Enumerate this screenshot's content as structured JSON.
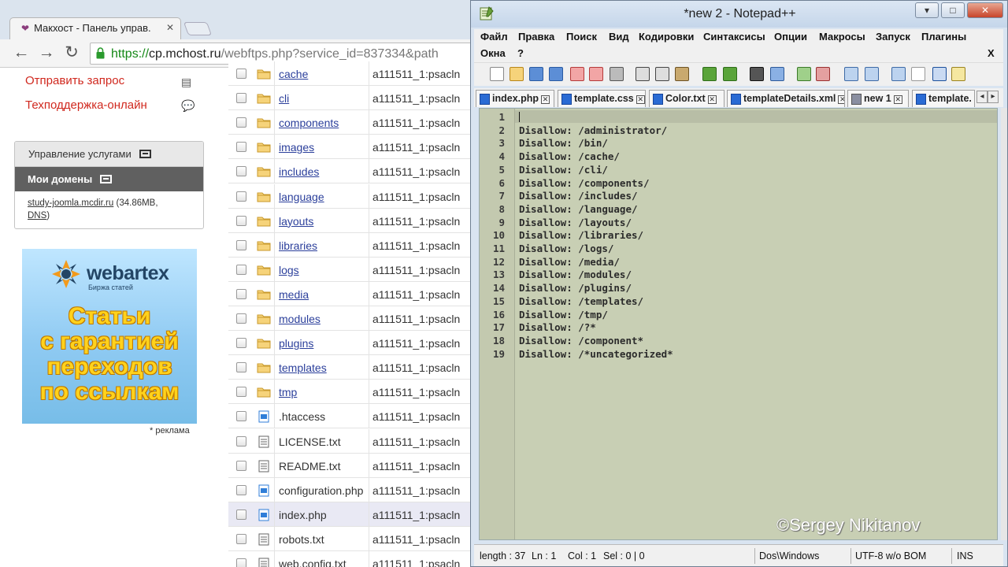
{
  "browser": {
    "tab_title": "Макхост - Панель управ.",
    "tab_close": "✕",
    "url_scheme": "https://",
    "url_host": "cp.mchost.ru",
    "url_path": "/webftps.php?service_id=837334&path",
    "nav": {
      "back": "←",
      "forward": "→",
      "reload": "↻"
    }
  },
  "sidebar": {
    "request_link": "Отправить запрос",
    "support_link": "Техподдержка-онлайн",
    "services_header": "Управление услугами",
    "domains_header": "Мои домены",
    "domain_name": "study-joomla.mcdir.ru",
    "domain_size": "(34.86MB,",
    "domain_dns": "DNS",
    "domain_close": ")",
    "ad": {
      "brand": "webartex",
      "tagline": "Биржа статей",
      "line1": "Статьи",
      "line2": "с гарантией",
      "line3": "переходов",
      "line4": "по ссылкам",
      "note": "* реклама"
    }
  },
  "files": [
    {
      "name": "cache",
      "type": "dir",
      "owner": "a111511_1:psacln"
    },
    {
      "name": "cli",
      "type": "dir",
      "owner": "a111511_1:psacln"
    },
    {
      "name": "components",
      "type": "dir",
      "owner": "a111511_1:psacln"
    },
    {
      "name": "images",
      "type": "dir",
      "owner": "a111511_1:psacln"
    },
    {
      "name": "includes",
      "type": "dir",
      "owner": "a111511_1:psacln"
    },
    {
      "name": "language",
      "type": "dir",
      "owner": "a111511_1:psacln"
    },
    {
      "name": "layouts",
      "type": "dir",
      "owner": "a111511_1:psacln"
    },
    {
      "name": "libraries",
      "type": "dir",
      "owner": "a111511_1:psacln"
    },
    {
      "name": "logs",
      "type": "dir",
      "owner": "a111511_1:psacln"
    },
    {
      "name": "media",
      "type": "dir",
      "owner": "a111511_1:psacln"
    },
    {
      "name": "modules",
      "type": "dir",
      "owner": "a111511_1:psacln"
    },
    {
      "name": "plugins",
      "type": "dir",
      "owner": "a111511_1:psacln"
    },
    {
      "name": "templates",
      "type": "dir",
      "owner": "a111511_1:psacln"
    },
    {
      "name": "tmp",
      "type": "dir",
      "owner": "a111511_1:psacln"
    },
    {
      "name": ".htaccess",
      "type": "code",
      "owner": "a111511_1:psacln"
    },
    {
      "name": "LICENSE.txt",
      "type": "text",
      "owner": "a111511_1:psacln"
    },
    {
      "name": "README.txt",
      "type": "text",
      "owner": "a111511_1:psacln"
    },
    {
      "name": "configuration.php",
      "type": "code",
      "owner": "a111511_1:psacln"
    },
    {
      "name": "index.php",
      "type": "code",
      "owner": "a111511_1:psacln",
      "selected": true
    },
    {
      "name": "robots.txt",
      "type": "text",
      "owner": "a111511_1:psacln"
    },
    {
      "name": "web.config.txt",
      "type": "text",
      "owner": "a111511_1:psacln"
    }
  ],
  "notepad": {
    "title": "*new  2 - Notepad++",
    "window_buttons": {
      "minimize": "▾",
      "maximize": "□",
      "close": "✕"
    },
    "menu": [
      "Файл",
      "Правка",
      "Поиск",
      "Вид",
      "Кодировки",
      "Синтаксисы",
      "Опции",
      "Макросы",
      "Запуск",
      "Плагины",
      "Окна",
      "?"
    ],
    "menu_close": "X",
    "tabs": [
      {
        "label": "index.php",
        "close": "✕"
      },
      {
        "label": "template.css",
        "close": "✕"
      },
      {
        "label": "Color.txt",
        "close": "✕"
      },
      {
        "label": "templateDetails.xml",
        "close": "✕"
      },
      {
        "label": "new  1",
        "close": "✕",
        "unsaved": true
      },
      {
        "label": "template.",
        "close": ""
      }
    ],
    "tab_scroll": {
      "left": "◂",
      "right": "▸"
    },
    "lines": [
      {
        "num": "1",
        "text": ""
      },
      {
        "num": "2",
        "text": "Disallow: /administrator/"
      },
      {
        "num": "3",
        "text": "Disallow: /bin/"
      },
      {
        "num": "4",
        "text": "Disallow: /cache/"
      },
      {
        "num": "5",
        "text": "Disallow: /cli/"
      },
      {
        "num": "6",
        "text": "Disallow: /components/"
      },
      {
        "num": "7",
        "text": "Disallow: /includes/"
      },
      {
        "num": "8",
        "text": "Disallow: /language/"
      },
      {
        "num": "9",
        "text": "Disallow: /layouts/"
      },
      {
        "num": "10",
        "text": "Disallow: /libraries/"
      },
      {
        "num": "11",
        "text": "Disallow: /logs/"
      },
      {
        "num": "12",
        "text": "Disallow: /media/"
      },
      {
        "num": "13",
        "text": "Disallow: /modules/"
      },
      {
        "num": "14",
        "text": "Disallow: /plugins/"
      },
      {
        "num": "15",
        "text": "Disallow: /templates/"
      },
      {
        "num": "16",
        "text": "Disallow: /tmp/"
      },
      {
        "num": "17",
        "text": "Disallow: /?*"
      },
      {
        "num": "18",
        "text": "Disallow: /component*"
      },
      {
        "num": "19",
        "text": "Disallow: /*uncategorized*"
      }
    ],
    "watermark": "©Sergey Nikitanov",
    "status": {
      "length": "length : 37",
      "ln": "Ln : 1",
      "col": "Col : 1",
      "sel": "Sel : 0 | 0",
      "eol": "Dos\\Windows",
      "encoding": "UTF-8 w/o BOM",
      "mode": "INS"
    }
  }
}
